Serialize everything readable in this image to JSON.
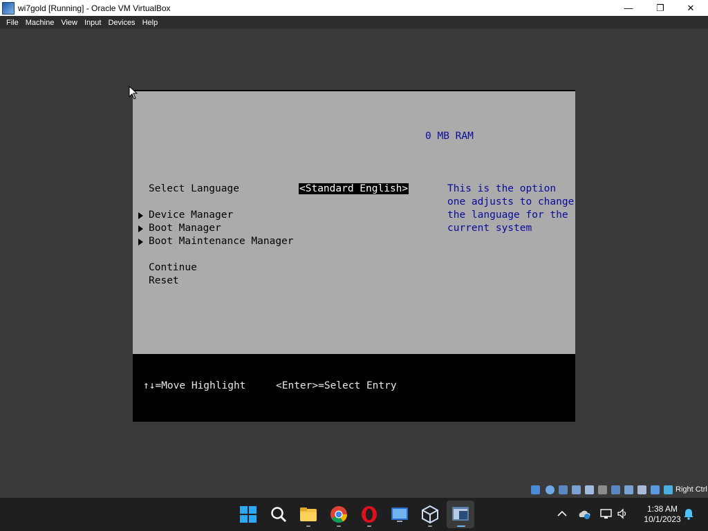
{
  "window": {
    "title": "wi7gold [Running] - Oracle VM VirtualBox",
    "minimize": "—",
    "maximize": "❐",
    "close": "✕"
  },
  "menu": [
    "File",
    "Machine",
    "View",
    "Input",
    "Devices",
    "Help"
  ],
  "bios": {
    "ram": "0 MB RAM",
    "select_language_label": "Select Language",
    "language_value": "<Standard English>",
    "help_lines": [
      "This is the option",
      "one adjusts to change",
      "the language for the",
      "current system"
    ],
    "submenus": [
      "Device Manager",
      "Boot Manager",
      "Boot Maintenance Manager"
    ],
    "actions": [
      "Continue",
      "Reset"
    ],
    "footer_move": "↑↓=Move Highlight",
    "footer_select": "<Enter>=Select Entry"
  },
  "statusbar": {
    "host_key": "Right Ctrl"
  },
  "taskbar": {
    "time": "1:38 AM",
    "date": "10/1/2023"
  }
}
